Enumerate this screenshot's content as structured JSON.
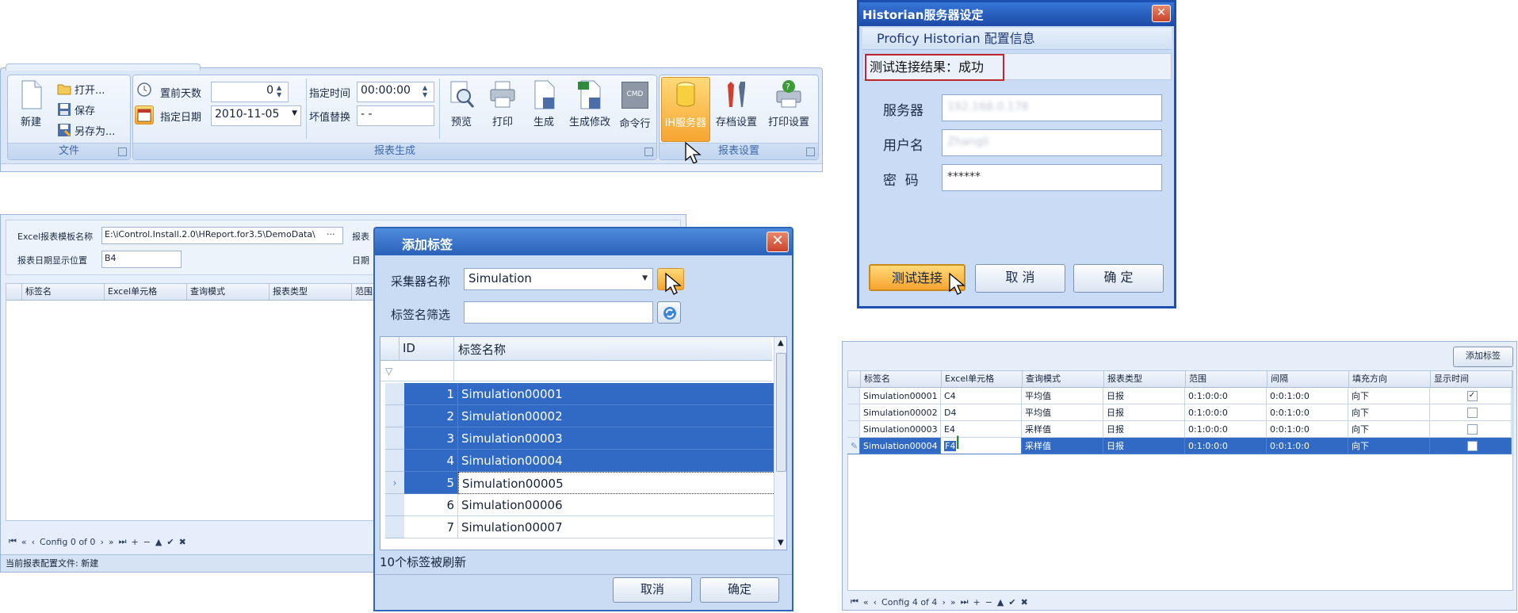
{
  "ribbon": {
    "file_group": {
      "title": "文件",
      "new": "新建",
      "open": "打开...",
      "save": "保存",
      "save_as": "另存为..."
    },
    "report_group": {
      "title": "报表生成",
      "days_before_label": "置前天数",
      "days_before_value": "0",
      "date_label": "指定日期",
      "date_value": "2010-11-05",
      "time_label": "指定时间",
      "time_value": "00:00:00",
      "bad_replace_label": "坏值替换",
      "bad_replace_value": "- -",
      "preview": "预览",
      "print": "打印",
      "generate": "生成",
      "generate_edit": "生成修改",
      "command": "命令行",
      "cmd_icon_text": "CMD"
    },
    "settings_group": {
      "title": "报表设置",
      "ih_server": "iH服务器",
      "archive": "存档设置",
      "print_settings": "打印设置"
    }
  },
  "config_panel": {
    "template_label": "Excel报表模板名称",
    "template_value": "E:\\iControl.Install.2.0\\HReport.for3.5\\DemoData\\",
    "date_pos_label": "报表日期显示位置",
    "date_pos_value": "B4",
    "right_label_1": "报表",
    "right_label_2": "日期",
    "columns": [
      "标签名",
      "Excel单元格",
      "查询模式",
      "报表类型",
      "范围"
    ],
    "nav_text": "Config 0 of 0",
    "status": "当前报表配置文件: 新建"
  },
  "add_tag_dialog": {
    "title": "添加标签",
    "collector_label": "采集器名称",
    "collector_value": "Simulation",
    "filter_label": "标签名筛选",
    "filter_value": "",
    "col_id": "ID",
    "col_name": "标签名称",
    "rows": [
      {
        "id": "1",
        "name": "Simulation00001"
      },
      {
        "id": "2",
        "name": "Simulation00002"
      },
      {
        "id": "3",
        "name": "Simulation00003"
      },
      {
        "id": "4",
        "name": "Simulation00004"
      },
      {
        "id": "5",
        "name": "Simulation00005"
      },
      {
        "id": "6",
        "name": "Simulation00006"
      },
      {
        "id": "7",
        "name": "Simulation00007"
      }
    ],
    "status": "10个标签被刷新",
    "cancel": "取消",
    "ok": "确定"
  },
  "historian_dialog": {
    "title": "Historian服务器设定",
    "subtitle": "Proficy Historian 配置信息",
    "result": "测试连接结果：成功",
    "server_label": "服务器",
    "server_value": "192.168.0.178",
    "user_label": "用户名",
    "user_value": "Zhangli",
    "password_label": "密  码",
    "password_value": "******",
    "test_button": "测试连接",
    "cancel_button": "取 消",
    "ok_button": "确 定"
  },
  "right_grid": {
    "add_tag_button": "添加标签",
    "columns": [
      "标签名",
      "Excel单元格",
      "查询模式",
      "报表类型",
      "范围",
      "间隔",
      "填充方向",
      "显示时间"
    ],
    "rows": [
      {
        "tag": "Simulation00001",
        "cell": "C4",
        "mode": "平均值",
        "type": "日报",
        "range": "0:1:0:0:0",
        "interval": "0:0:1:0:0",
        "dir": "向下",
        "show": true
      },
      {
        "tag": "Simulation00002",
        "cell": "D4",
        "mode": "平均值",
        "type": "日报",
        "range": "0:1:0:0:0",
        "interval": "0:0:1:0:0",
        "dir": "向下",
        "show": false
      },
      {
        "tag": "Simulation00003",
        "cell": "E4",
        "mode": "采样值",
        "type": "日报",
        "range": "0:1:0:0:0",
        "interval": "0:0:1:0:0",
        "dir": "向下",
        "show": false
      },
      {
        "tag": "Simulation00004",
        "cell": "F4",
        "mode": "采样值",
        "type": "日报",
        "range": "0:1:0:0:0",
        "interval": "0:0:1:0:0",
        "dir": "向下",
        "show": false
      }
    ],
    "nav_text": "Config 4 of 4"
  },
  "colors": {
    "accent_blue": "#316ac5",
    "titlebar_blue": "#2a61b8",
    "highlight_orange": "#f6a530",
    "ribbon_bg": "#dbe7f6",
    "alert_red": "#c0262d"
  }
}
